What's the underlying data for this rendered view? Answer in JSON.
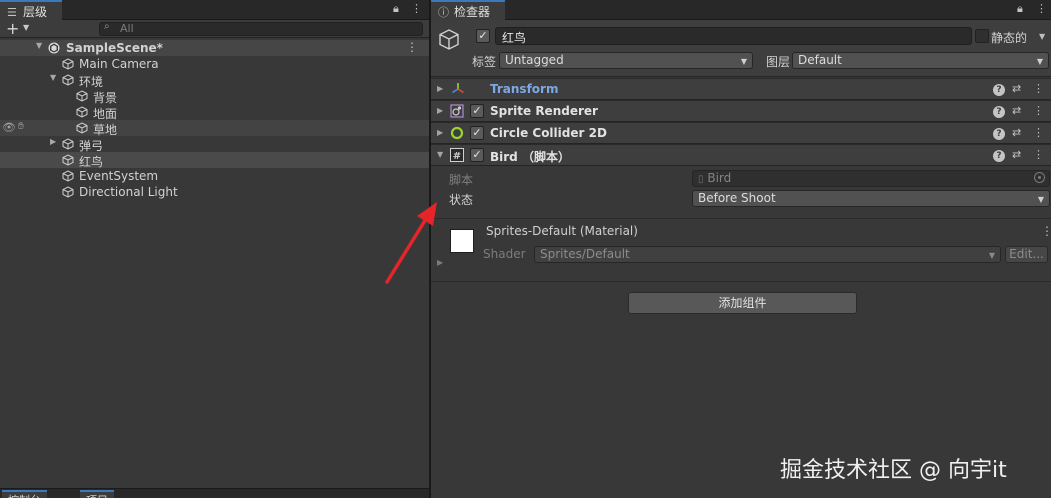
{
  "hierarchy": {
    "tab_label": "层级",
    "search_placeholder": "All",
    "scene_name": "SampleScene*",
    "items": [
      {
        "label": "Main Camera"
      },
      {
        "label": "环境"
      },
      {
        "label": "背景"
      },
      {
        "label": "地面"
      },
      {
        "label": "草地"
      },
      {
        "label": "弹弓"
      },
      {
        "label": "红鸟"
      },
      {
        "label": "EventSystem"
      },
      {
        "label": "Directional Light"
      }
    ],
    "bottom_tabs": [
      "控制台",
      "项目"
    ]
  },
  "inspector": {
    "tab_label": "检查器",
    "object_name": "红鸟",
    "static_label": "静态的",
    "tag_label": "标签",
    "tag_value": "Untagged",
    "layer_label": "图层",
    "layer_value": "Default",
    "components": [
      {
        "title": "Transform"
      },
      {
        "title": "Sprite Renderer"
      },
      {
        "title": "Circle Collider 2D"
      },
      {
        "title": "Bird （脚本）"
      }
    ],
    "script_field": {
      "label": "脚本",
      "value": "Bird"
    },
    "state_field": {
      "label": "状态",
      "value": "Before Shoot"
    },
    "material": {
      "name": "Sprites-Default (Material)",
      "shader_label": "Shader",
      "shader_value": "Sprites/Default",
      "edit_label": "Edit..."
    },
    "add_component_label": "添加组件"
  },
  "colors": {
    "tab_accent": "#3a79bb",
    "transform_title": "#7ca8e6",
    "annotation_arrow": "#e5252a",
    "collider_icon": "#9bd32c"
  },
  "watermark": "掘金技术社区 @ 向宇it"
}
